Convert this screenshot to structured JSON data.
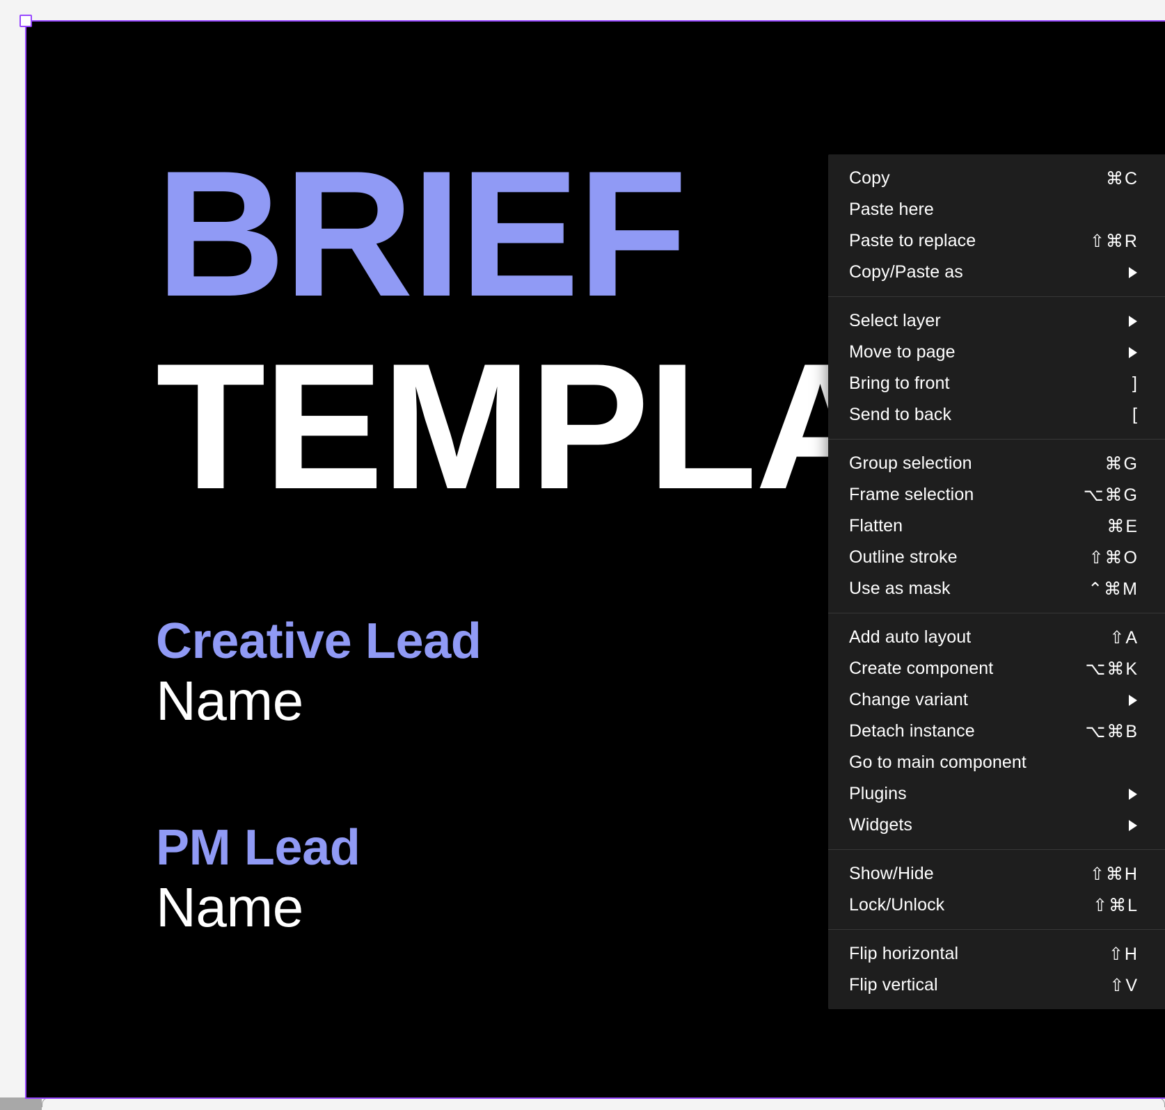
{
  "canvas": {
    "background_color": "#000000",
    "accent_color": "#909af5",
    "text_color": "#ffffff",
    "headline_line1": "BRIEF",
    "headline_line2": "TEMPLATE",
    "roles": [
      {
        "label": "Creative Lead",
        "value": "Name"
      },
      {
        "label": "PM Lead",
        "value": "Name"
      }
    ]
  },
  "selection": {
    "border_color": "#9747ff",
    "handle_fill": "#ffffff"
  },
  "context_menu": {
    "background_color": "#1e1e1e",
    "groups": [
      {
        "items": [
          {
            "label": "Copy",
            "shortcut": "⌘C",
            "submenu": false
          },
          {
            "label": "Paste here",
            "shortcut": "",
            "submenu": false
          },
          {
            "label": "Paste to replace",
            "shortcut": "⇧⌘R",
            "submenu": false
          },
          {
            "label": "Copy/Paste as",
            "shortcut": "",
            "submenu": true
          }
        ]
      },
      {
        "items": [
          {
            "label": "Select layer",
            "shortcut": "",
            "submenu": true
          },
          {
            "label": "Move to page",
            "shortcut": "",
            "submenu": true
          },
          {
            "label": "Bring to front",
            "shortcut": "]",
            "submenu": false
          },
          {
            "label": "Send to back",
            "shortcut": "[",
            "submenu": false
          }
        ]
      },
      {
        "items": [
          {
            "label": "Group selection",
            "shortcut": "⌘G",
            "submenu": false
          },
          {
            "label": "Frame selection",
            "shortcut": "⌥⌘G",
            "submenu": false
          },
          {
            "label": "Flatten",
            "shortcut": "⌘E",
            "submenu": false
          },
          {
            "label": "Outline stroke",
            "shortcut": "⇧⌘O",
            "submenu": false
          },
          {
            "label": "Use as mask",
            "shortcut": "⌃⌘M",
            "submenu": false
          }
        ]
      },
      {
        "items": [
          {
            "label": "Add auto layout",
            "shortcut": "⇧A",
            "submenu": false
          },
          {
            "label": "Create component",
            "shortcut": "⌥⌘K",
            "submenu": false
          },
          {
            "label": "Change variant",
            "shortcut": "",
            "submenu": true
          },
          {
            "label": "Detach instance",
            "shortcut": "⌥⌘B",
            "submenu": false
          },
          {
            "label": "Go to main component",
            "shortcut": "",
            "submenu": false
          },
          {
            "label": "Plugins",
            "shortcut": "",
            "submenu": true
          },
          {
            "label": "Widgets",
            "shortcut": "",
            "submenu": true
          }
        ]
      },
      {
        "items": [
          {
            "label": "Show/Hide",
            "shortcut": "⇧⌘H",
            "submenu": false
          },
          {
            "label": "Lock/Unlock",
            "shortcut": "⇧⌘L",
            "submenu": false
          }
        ]
      },
      {
        "items": [
          {
            "label": "Flip horizontal",
            "shortcut": "⇧H",
            "submenu": false
          },
          {
            "label": "Flip vertical",
            "shortcut": "⇧V",
            "submenu": false
          }
        ]
      }
    ]
  }
}
